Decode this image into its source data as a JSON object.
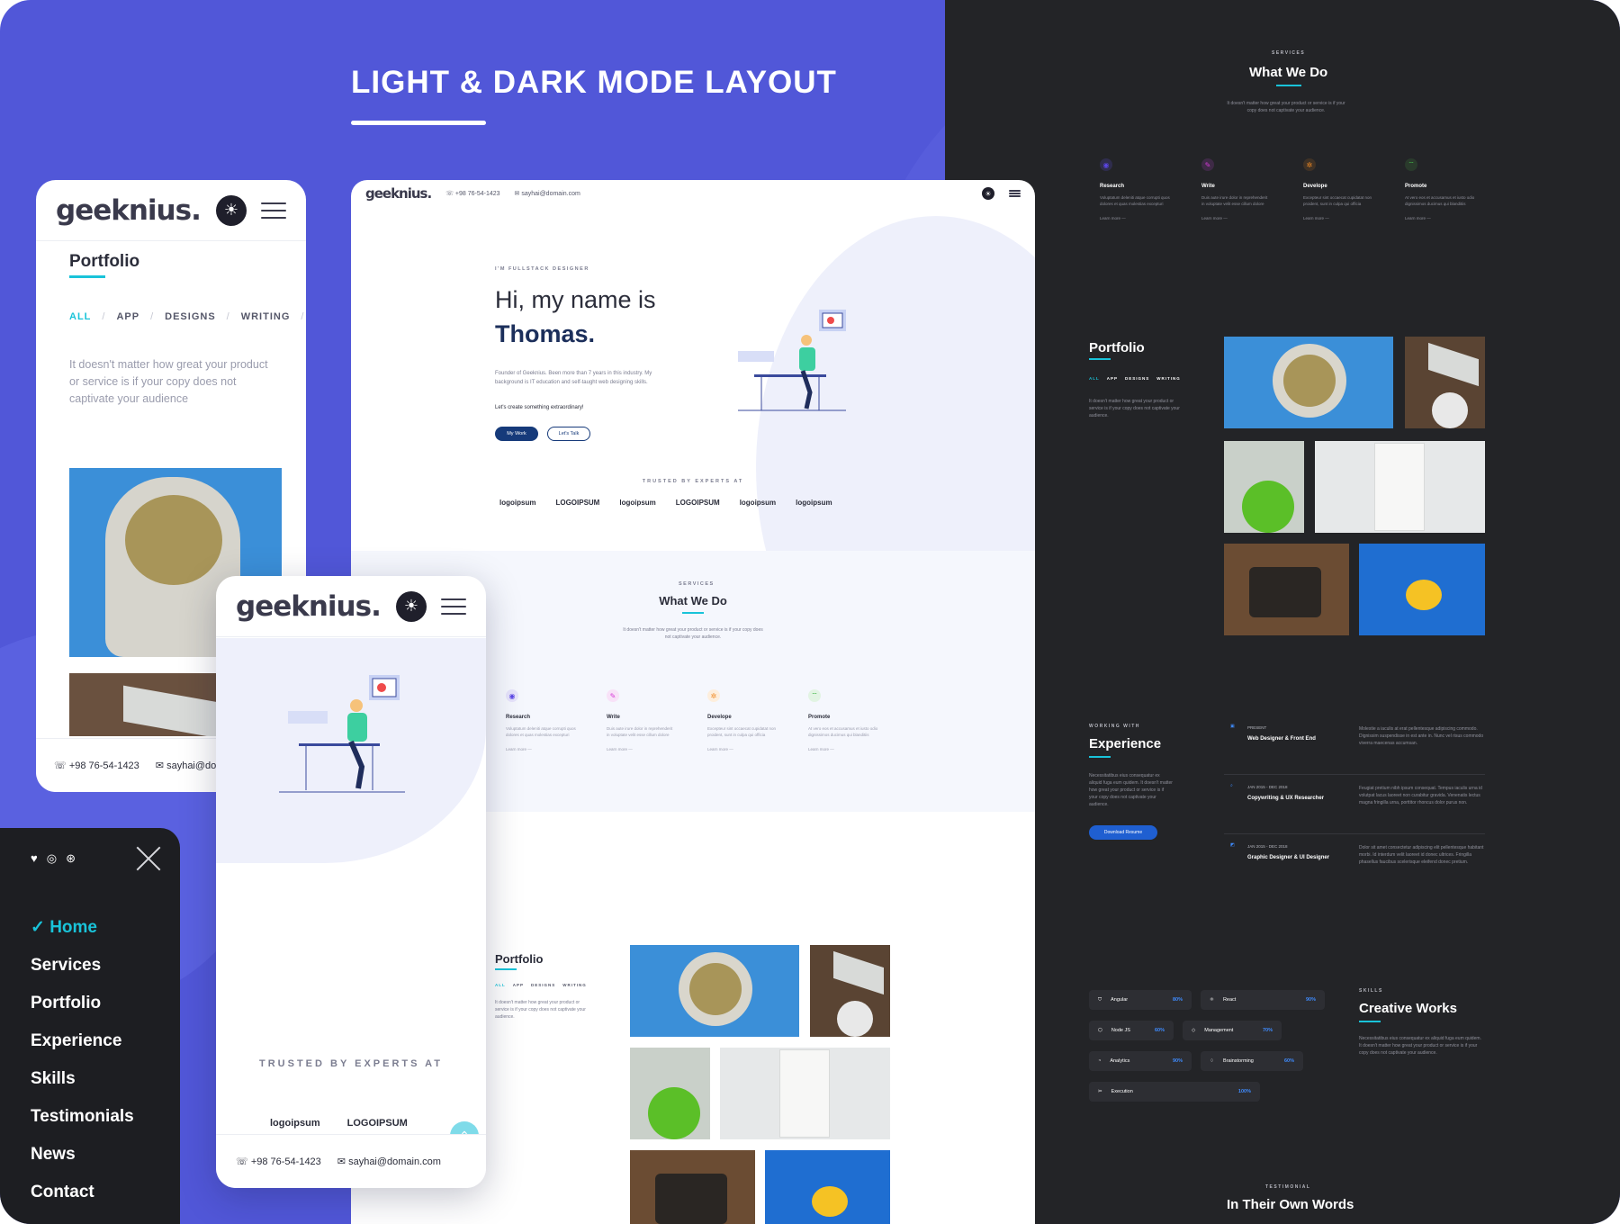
{
  "heading": "LIGHT & DARK MODE LAYOUT",
  "brand": "geeknius.",
  "phone_portfolio": {
    "title": "Portfolio",
    "filters": [
      "ALL",
      "APP",
      "DESIGNS",
      "WRITING"
    ],
    "description": "It doesn't matter how great your product or service is if your copy does not captivate your audience",
    "phone": "+98 76-54-1423",
    "email": "sayhai@domain.com"
  },
  "menu": {
    "items": [
      "Home",
      "Services",
      "Portfolio",
      "Experience",
      "Skills",
      "Testimonials",
      "News",
      "Contact"
    ],
    "active": "Home"
  },
  "desktop": {
    "nav": {
      "phone": "+98 76-54-1423",
      "email": "sayhai@domain.com"
    },
    "kicker": "I'M FULLSTACK DESIGNER",
    "greeting": "Hi, my name is",
    "name": "Thomas.",
    "bio": "Founder of Geeknius. Been more than 7 years in this industry. My background is IT education and self-taught web designing skills.",
    "cta": "Let's create something extraordinary!",
    "btn_primary": "My Work",
    "btn_secondary": "Let's Talk",
    "trusted": "TRUSTED BY EXPERTS AT",
    "logos": [
      "logoipsum",
      "LOGOIPSUM",
      "logoipsum",
      "LOGOIPSUM",
      "logoipsum",
      "logoipsum"
    ],
    "services_kicker": "SERVICES",
    "services_title": "What We Do",
    "services_desc": "It doesn't matter how great your product or service is if your copy does not captivate your audience.",
    "services": [
      {
        "name": "Research",
        "desc": "Voluptatum deleniti atque corrupti quos dolores et quas molestias excepturi",
        "icon": "research-icon",
        "color": "#5b46e6"
      },
      {
        "name": "Write",
        "desc": "Duis aute irure dolor in reprehenderit in voluptate velit esse cillum dolore",
        "icon": "pen-icon",
        "color": "#d63ad8"
      },
      {
        "name": "Develope",
        "desc": "Excepteur sint occaecat cupidatat non proident, sunt in culpa qui officia",
        "icon": "gear-icon",
        "color": "#f08a24"
      },
      {
        "name": "Promote",
        "desc": "At vero eos et accusamus et iusto odio dignissimos ducimus qui blanditiis",
        "icon": "broadcast-icon",
        "color": "#44b84a"
      }
    ],
    "learn_more": "Learn more —",
    "portfolio_title": "Portfolio",
    "portfolio_filters": [
      "ALL",
      "APP",
      "DESIGNS",
      "WRITING"
    ],
    "portfolio_desc": "It doesn't matter how great your product or service is if your copy does not captivate your audience."
  },
  "phone_hero": {
    "trusted": "TRUSTED BY EXPERTS AT",
    "logos": [
      "logoipsum",
      "LOGOIPSUM"
    ],
    "phone": "+98 76-54-1423",
    "email": "sayhai@domain.com"
  },
  "dark": {
    "services_kicker": "SERVICES",
    "services_title": "What We Do",
    "services_desc": "It doesn't matter how great your product or service is if your copy does not captivate your audience.",
    "services": [
      {
        "name": "Research",
        "desc": "Voluptatum deleniti atque corrupti quos dolores et quas molestias excepturi",
        "color": "#5b46e6"
      },
      {
        "name": "Write",
        "desc": "Duis aute irure dolor in reprehenderit in voluptate velit esse cillum dolore",
        "color": "#d63ad8"
      },
      {
        "name": "Develope",
        "desc": "Excepteur sint occaecat cupidatat non proident, sunt in culpa qui officia",
        "color": "#f08a24"
      },
      {
        "name": "Promote",
        "desc": "At vero eos et accusamus et iusto odio dignissimos ducimus qui blanditiis",
        "color": "#44b84a"
      }
    ],
    "learn_more": "Learn more —",
    "portfolio_title": "Portfolio",
    "portfolio_filters": [
      "ALL",
      "APP",
      "DESIGNS",
      "WRITING"
    ],
    "portfolio_desc": "It doesn't matter how great your product or service is if your copy does not captivate your audience.",
    "experience_kicker": "WORKING WITH",
    "experience_title": "Experience",
    "experience_desc": "Necessitatibus eius consequatur ex aliquid fuga eum quidem. It doesn't matter how great your product or service is if your copy does not captivate your audience.",
    "download_btn": "Download Resume",
    "jobs": [
      {
        "period": "PRESENT",
        "role": "Web Designer & Front End",
        "desc": "Molestie a iaculis at erat pellentesque adipiscing commodo. Dignissim suspendisse in est ante in. Nunc vel risus commodo viverra maecenas accumsan."
      },
      {
        "period": "JAN 2015 - DEC 2018",
        "role": "Copywriting & UX Researcher",
        "desc": "Feugiat pretium nibh ipsum consequat. Tempus iaculis urna id volutpat lacus laoreet non curabitur gravida. Venenatis lectus magna fringilla urna, porttitor rhoncus dolor purus non."
      },
      {
        "period": "JAN 2015 - DEC 2018",
        "role": "Graphic Designer & UI Designer",
        "desc": "Dolor sit amet consectetur adipiscing elit pellentesque habitant morbi. Id interdum velit laoreet id donec ultrices. Fringilla phasellus faucibus scelerisque eleifend donec pretium."
      }
    ],
    "skills": [
      {
        "name": "Angular",
        "pct": "80%"
      },
      {
        "name": "React",
        "pct": "90%"
      },
      {
        "name": "Node JS",
        "pct": "60%"
      },
      {
        "name": "Management",
        "pct": "70%"
      },
      {
        "name": "Analytics",
        "pct": "90%"
      },
      {
        "name": "Brainstorming",
        "pct": "60%"
      },
      {
        "name": "Execution",
        "pct": "100%"
      }
    ],
    "skills_kicker": "SKILLS",
    "skills_title": "Creative Works",
    "skills_desc": "Necessitatibus eius consequatur ex aliquid fuga eum quidem. It doesn't matter how great your product or service is if your copy does not captivate your audience.",
    "testimonial_kicker": "TESTIMONIAL",
    "testimonial_title": "In Their Own Words"
  }
}
